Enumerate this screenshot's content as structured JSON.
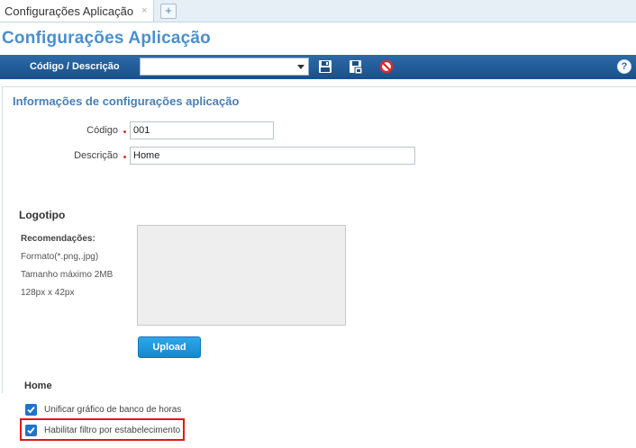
{
  "tabs": [
    {
      "label": "Configurações Aplicação",
      "close": "×"
    }
  ],
  "tab_add_label": "+",
  "page": {
    "title": "Configurações Aplicação"
  },
  "toolbar": {
    "label": "Código / Descrição",
    "select_value": "",
    "icons": [
      "save-icon",
      "save-copy-icon",
      "cancel-icon"
    ],
    "help_label": "?"
  },
  "section": {
    "title": "Informações de configurações aplicação"
  },
  "form": {
    "codigo": {
      "label": "Código",
      "value": "001"
    },
    "descricao": {
      "label": "Descrição",
      "value": "Home"
    }
  },
  "logo": {
    "title": "Logotipo",
    "recommendations_title": "Recomendações:",
    "format": "Formato(*.png,.jpg)",
    "max_size": "Tamanho máximo 2MB",
    "dimensions": "128px x 42px",
    "upload_label": "Upload"
  },
  "home": {
    "title": "Home",
    "options": [
      {
        "label": "Unificar gráfico de banco de horas",
        "checked": true
      },
      {
        "label": "Habilitar filtro por estabelecimento",
        "checked": true,
        "highlighted": true
      }
    ]
  },
  "colors": {
    "accent": "#4a8fce",
    "toolbar": "#19508a",
    "required": "#dd3333",
    "highlight": "#e01818",
    "button": "#1488cf"
  }
}
